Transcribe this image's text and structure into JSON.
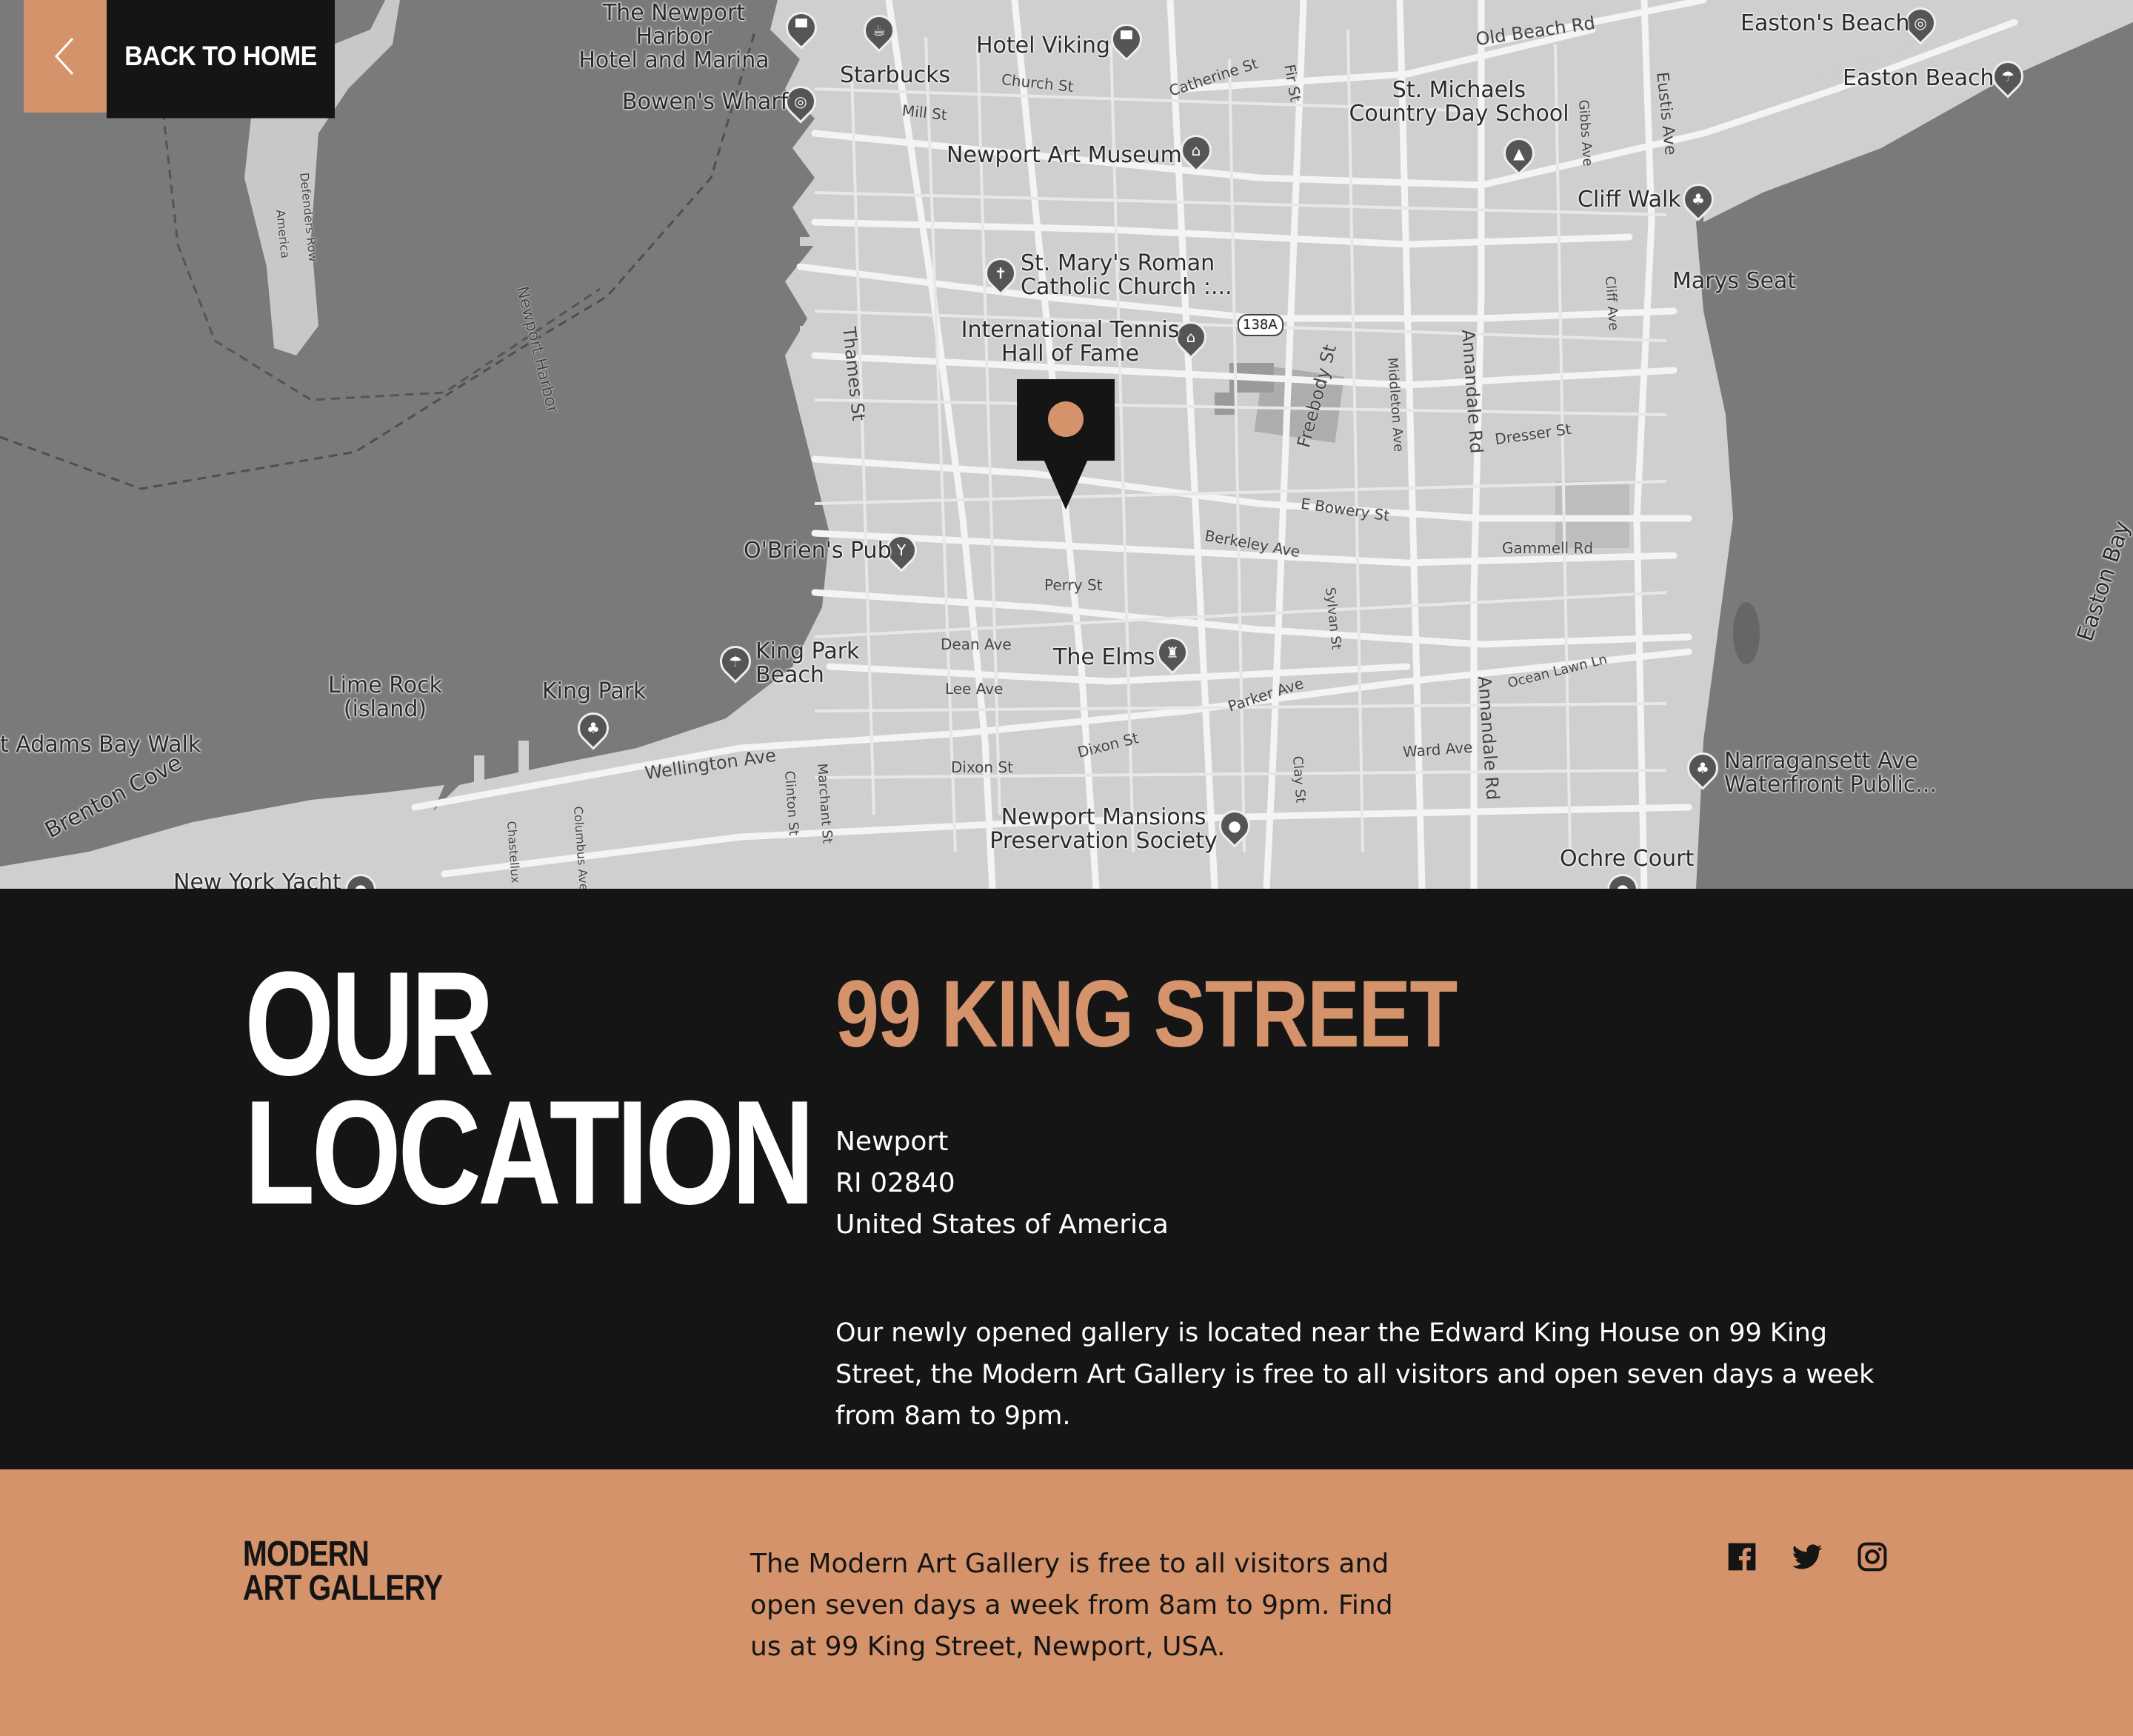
{
  "nav": {
    "back_label": "Back to Home"
  },
  "map": {
    "places": {
      "newport_harbor_hotel": "The Newport Harbor\nHotel and Marina",
      "starbucks": "Starbucks",
      "hotel_viking": "Hotel Viking",
      "bowens_wharf": "Bowen's Wharf",
      "newport_art_museum": "Newport Art Museum",
      "st_marys": "St. Mary's Roman\nCatholic Church :...",
      "tennis_hof": "International Tennis\nHall of Fame",
      "st_michaels": "St. Michaels\nCountry Day School",
      "eastons_beach": "Easton's Beach",
      "easton_beach": "Easton Beach",
      "cliff_walk": "Cliff Walk",
      "marys_seat": "Marys Seat",
      "obriens_pub": "O'Brien's Pub",
      "king_park_beach": "King Park\nBeach",
      "lime_rock": "Lime Rock\n(island)",
      "king_park": "King Park",
      "adams_bay_walk": "t Adams Bay Walk",
      "the_elms": "The Elms",
      "newport_mansions": "Newport Mansions\nPreservation Society",
      "narragansett": "Narragansett Ave\nWaterfront Public...",
      "ochre_court": "Ochre Court",
      "brenton_cove": "Brenton Cove",
      "new_york_yacht": "New York Yacht",
      "easton_bay": "Easton Bay"
    },
    "streets": {
      "old_beach_rd": "Old Beach Rd",
      "church_st": "Church St",
      "mill_st": "Mill St",
      "catherine_st": "Catherine St",
      "thames_st": "Thames St",
      "freebody_st": "Freebody St",
      "annandale_rd": "Annandale Rd",
      "dresser_st": "Dresser St",
      "e_bowery_st": "E Bowery St",
      "berkeley_ave": "Berkeley Ave",
      "gammell_rd": "Gammell Rd",
      "perry_st": "Perry St",
      "dean_ave": "Dean Ave",
      "lee_ave": "Lee Ave",
      "parker_ave": "Parker Ave",
      "wellington_ave": "Wellington Ave",
      "dixon_st": "Dixon St",
      "ward_ave": "Ward Ave",
      "ocean_lawn": "Ocean Lawn Ln",
      "newport_harbor": "Newport Harbor",
      "defenders_row": "Defenders Row",
      "america": "America",
      "eustis_ave": "Eustis Ave",
      "gibbs_ave": "Gibbs Ave",
      "cliff_ave": "Cliff Ave",
      "middleton_ave": "Middleton Ave",
      "sylvan_st": "Sylvan St",
      "clay_st": "Clay St",
      "clinton_st": "Clinton St",
      "marchant_st": "Marchant St",
      "columbus_ave": "Columbus Ave",
      "chastellux": "Chastellux",
      "route_138a": "138A",
      "fir_st": "Fir St"
    }
  },
  "location": {
    "title_line1": "OUR",
    "title_line2": "LOCATION",
    "street": "99 KING STREET",
    "city": "Newport",
    "region": "RI 02840",
    "country": "United States of America",
    "description": "Our newly opened gallery is located near the Edward King House on 99 King Street, the Modern Art Gallery is free to all visitors and open seven days a week from 8am to 9pm."
  },
  "footer": {
    "logo_line1": "MODERN",
    "logo_line2": "ART GALLERY",
    "text": "The Modern Art Gallery is free to all visitors and open seven days a week from 8am to 9pm. Find us at 99 King Street, Newport, USA.",
    "social": [
      "facebook-icon",
      "twitter-icon",
      "instagram-icon"
    ]
  },
  "colors": {
    "accent": "#d4936b",
    "dark": "#151515",
    "map_water": "#7a7a7a",
    "map_land": "#cfcfcf"
  }
}
